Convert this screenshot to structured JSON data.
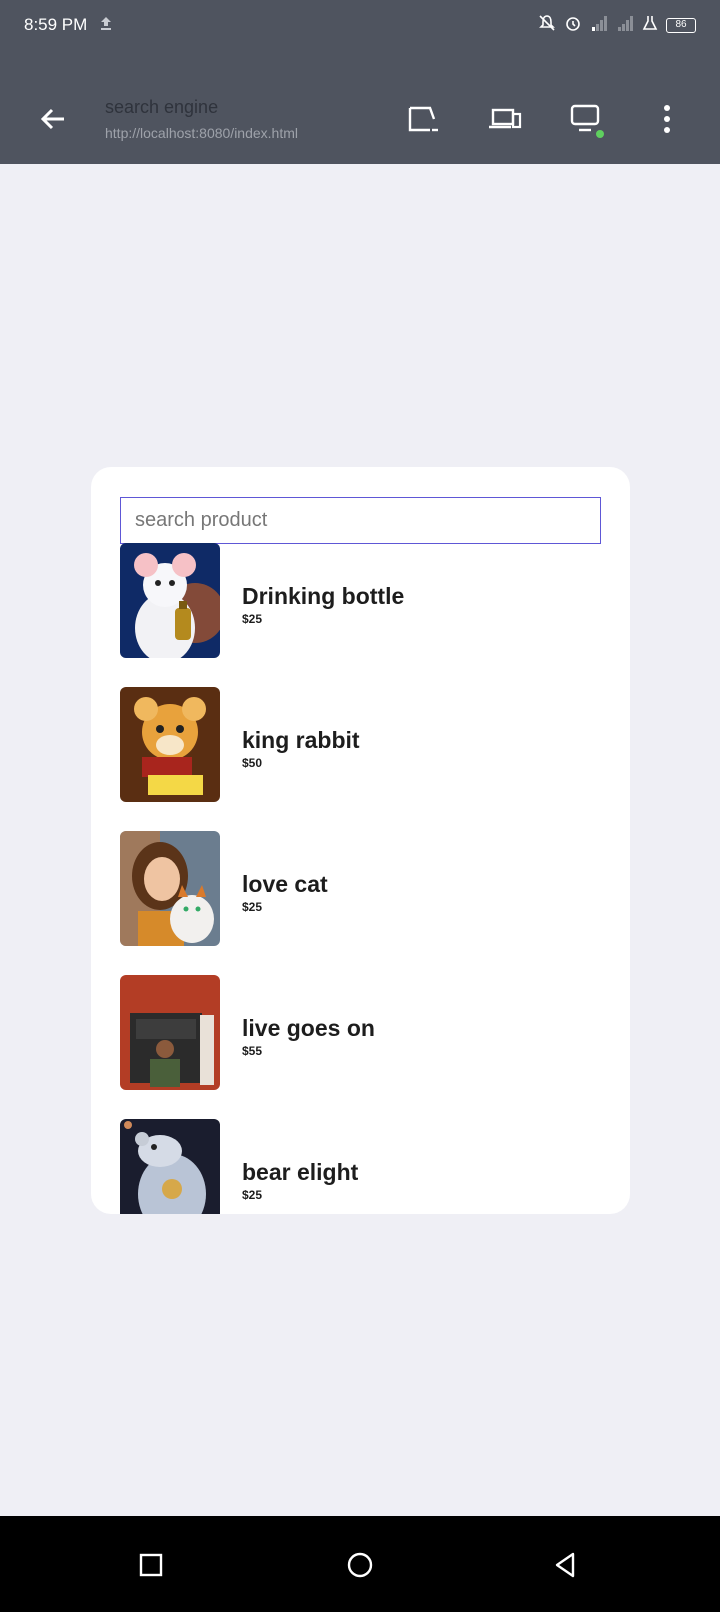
{
  "status": {
    "time": "8:59 PM",
    "battery": "86",
    "icons": [
      "upload-icon",
      "mute-icon",
      "alarm-icon",
      "signal-icon",
      "signal-icon",
      "flask-icon",
      "battery-icon"
    ]
  },
  "appbar": {
    "title": "search engine",
    "url": "http://localhost:8080/index.html",
    "icons": [
      "back-arrow-icon",
      "cast-screen-icon",
      "devices-icon",
      "desktop-icon",
      "more-vert-icon"
    ]
  },
  "search": {
    "placeholder": "search product",
    "value": ""
  },
  "products": [
    {
      "name": "Drinking bottle",
      "price": "$25",
      "image": "mouse-with-bottle"
    },
    {
      "name": "king rabbit",
      "price": "$50",
      "image": "hamster-with-butter"
    },
    {
      "name": "love cat",
      "price": "$25",
      "image": "girl-with-cat"
    },
    {
      "name": "live goes on",
      "price": "$55",
      "image": "woman-in-studio"
    },
    {
      "name": "bear elight",
      "price": "$25",
      "image": "ornate-bear"
    }
  ],
  "navigation": {
    "icons": [
      "square-recents-icon",
      "circle-home-icon",
      "triangle-back-icon"
    ]
  }
}
